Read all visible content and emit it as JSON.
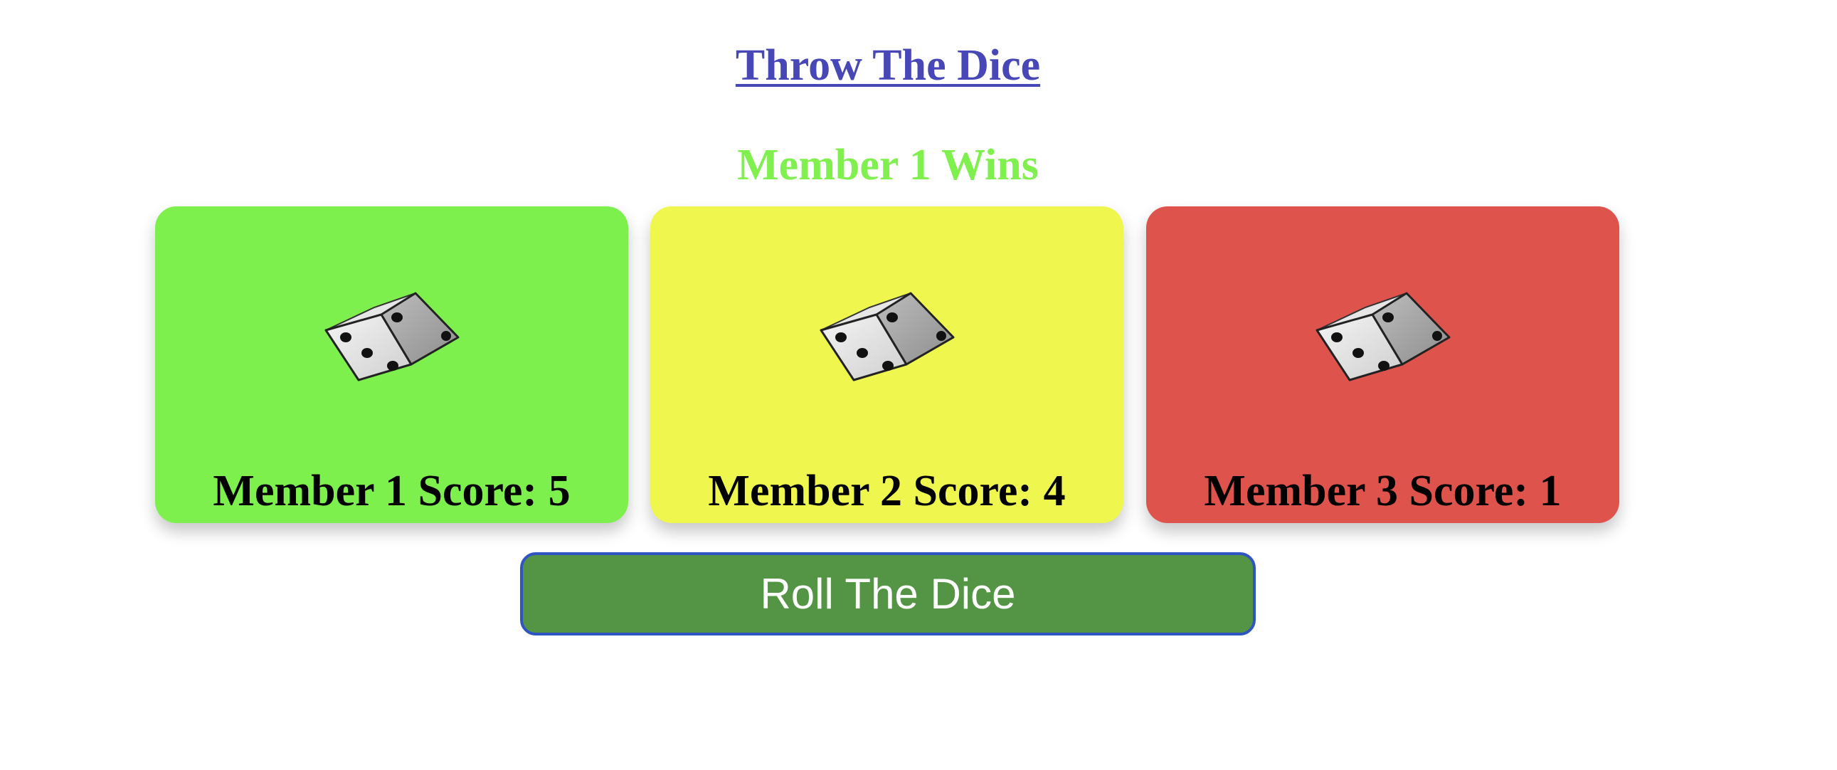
{
  "header": {
    "title": "Throw The Dice",
    "winner_text": "Member 1 Wins"
  },
  "members": [
    {
      "score_label": "Member 1 Score: 5",
      "color": "#7ef04e",
      "dice_icon": "dice-icon"
    },
    {
      "score_label": "Member 2 Score: 4",
      "color": "#eff74f",
      "dice_icon": "dice-icon"
    },
    {
      "score_label": "Member 3 Score: 1",
      "color": "#de534b",
      "dice_icon": "dice-icon"
    }
  ],
  "controls": {
    "roll_label": "Roll The Dice",
    "roll_color": "#539544"
  },
  "colors": {
    "title": "#4747b8",
    "winner": "#7ff04e"
  }
}
